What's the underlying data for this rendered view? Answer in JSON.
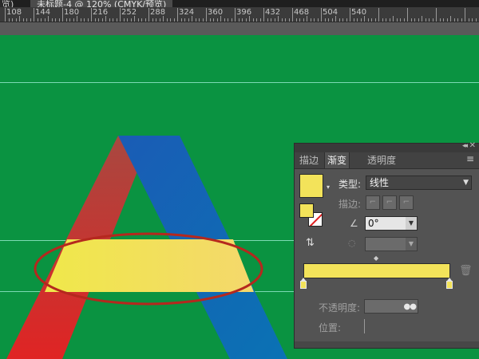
{
  "tabbar": {
    "left_tab": "览)",
    "doc_tab": "未标题-4 @ 120% (CMYK/预览)"
  },
  "ruler": {
    "numbers": [
      "108",
      "144",
      "180",
      "216",
      "252",
      "288",
      "324",
      "360",
      "396",
      "432",
      "468",
      "504",
      "540"
    ]
  },
  "colors": {
    "background": "#0a9341",
    "swatch_yellow": "#f3e35a",
    "ellipse_red": "#b5281e",
    "letter_red": "#e02424",
    "letter_blue": "#1061b3"
  },
  "panel": {
    "tabs": [
      "描边",
      "渐变",
      "透明度"
    ],
    "active_tab": "渐变",
    "menu_icon": "panel-menu-icon",
    "collapse_icon": "collapse-icon",
    "close_icon": "close-icon",
    "type_label": "类型:",
    "type_value": "线性",
    "stroke_label": "描边:",
    "angle_value": "0°",
    "opacity_label": "不透明度:",
    "location_label": "位置:",
    "gradient_start_color": "#f3e35a",
    "gradient_end_color": "#f3e35a"
  }
}
